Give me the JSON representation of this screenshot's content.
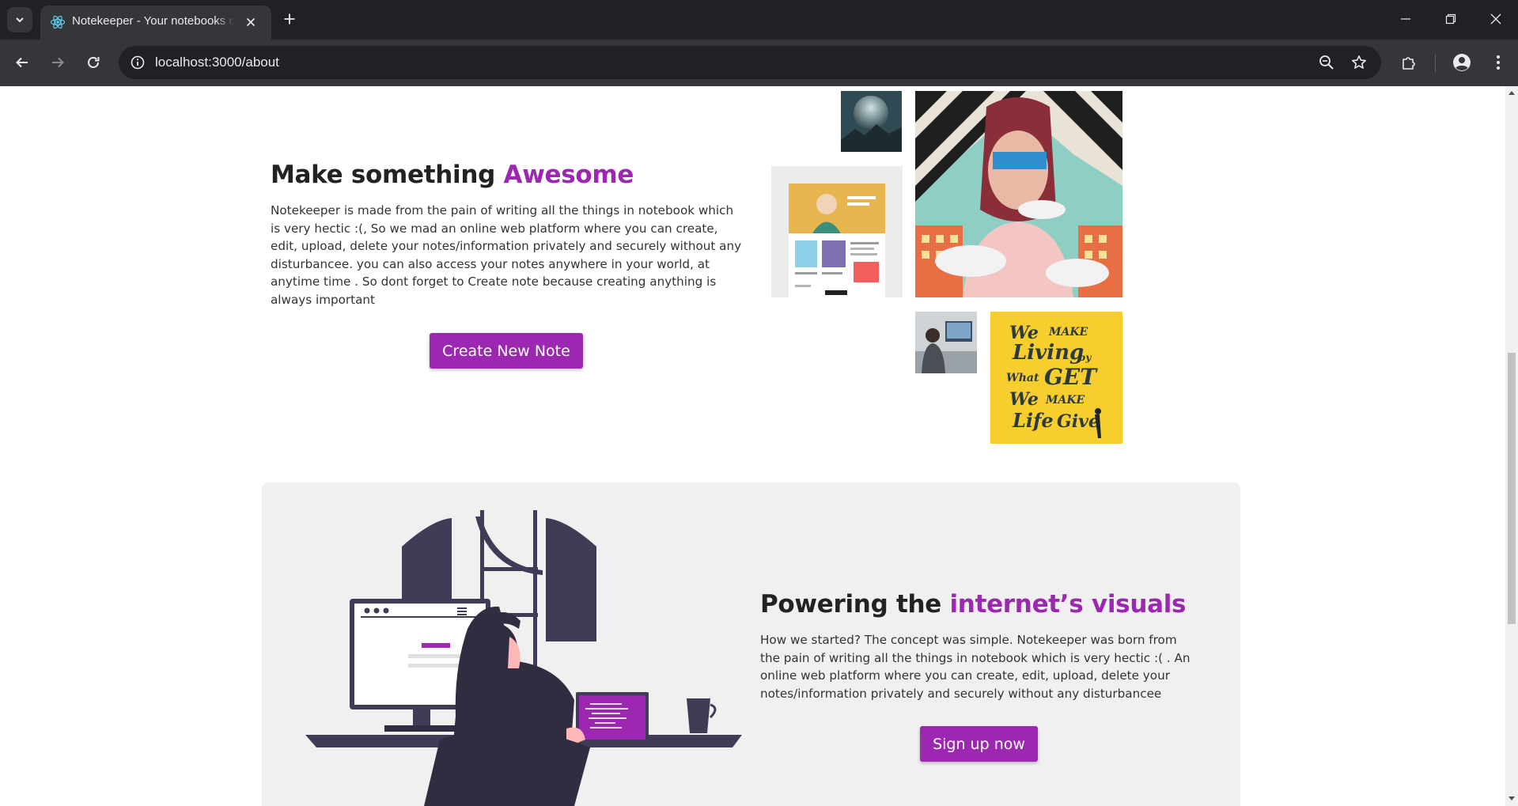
{
  "browser": {
    "tab_title": "Notekeeper - Your notebooks on the cloud",
    "url": "localhost:3000/about"
  },
  "section_awesome": {
    "heading_prefix": "Make something ",
    "heading_accent": "Awesome",
    "body": "Notekeeper is made from the pain of writing all the things in notebook which is very hectic :(, So we mad an online web platform where you can create, edit, upload, delete your notes/information privately and securely without any disturbancee. you can also access your notes anywhere in your world, at anytime time . So dont forget to Create note because creating anything is always important",
    "button": "Create New Note"
  },
  "section_visuals": {
    "heading_prefix": "Powering the ",
    "heading_accent": "internet’s visuals",
    "body": "How we started? The concept was simple. Notekeeper was born from the pain of writing all the things in notebook which is very hectic :( . An online web platform where you can create, edit, upload, delete your notes/information privately and securely without any disturbancee",
    "button": "Sign up now"
  },
  "colors": {
    "accent": "#9c27b0",
    "heading": "#222222",
    "panel": "#f1f0f1"
  }
}
